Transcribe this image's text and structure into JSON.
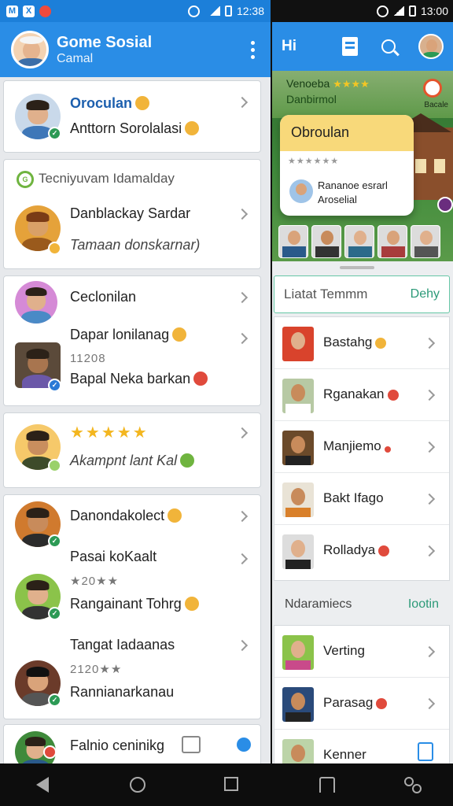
{
  "status_left": {
    "icons": [
      "app-icon-m",
      "app-icon-x",
      "notification-dot"
    ],
    "time": "12:38"
  },
  "status_right": {
    "time": "13:00"
  },
  "left_header": {
    "title": "Gome Sosial",
    "subtitle": "Camal"
  },
  "left_cards": [
    {
      "name": "Oroculan",
      "message": "Anttorn Sorolalasi"
    },
    {
      "header": "Tecniyuvam Idamalday",
      "name": "Danblackay Sardar",
      "message": "Tamaan donskarnar)"
    },
    {
      "name": "Ceclonilan"
    },
    {
      "name": "Dapar lonilanag",
      "meta": "11208",
      "message": "Bapal Neka barkan"
    },
    {
      "stars": "★★★★★",
      "message": "Akampnt lant Kal"
    },
    {
      "name": "Danondakolect"
    },
    {
      "name": "Pasai koKaalt",
      "meta": "★20★★",
      "message": "Rangainant Tohrg"
    },
    {
      "name": "Tangat Iadaanas",
      "meta": "2120★★",
      "message": "Rannianarkanau"
    },
    {
      "name": "Falnio ceninikg"
    }
  ],
  "right_header": {
    "label": "Hi"
  },
  "right_banner": {
    "name": "Venoeba",
    "stars": "★★★★",
    "subtitle": "Danbirmol",
    "tag": "Bacale",
    "popup_title": "Obroulan",
    "popup_stars": "★★★★★★",
    "popup_line1": "Rananoe esrarl",
    "popup_line2": "Aroselial"
  },
  "right_search": {
    "placeholder": "Liatat Temmm",
    "action": "Dehy"
  },
  "right_list": [
    {
      "label": "Bastahg"
    },
    {
      "label": "Rganakan"
    },
    {
      "label": "Manjiemo"
    },
    {
      "label": "Bakt Ifago"
    },
    {
      "label": "Rolladya"
    }
  ],
  "right_section": {
    "title": "Ndaramiecs",
    "action": "Iootin"
  },
  "right_list2": [
    {
      "label": "Verting"
    },
    {
      "label": "Parasag"
    },
    {
      "label": "Kenner"
    }
  ]
}
